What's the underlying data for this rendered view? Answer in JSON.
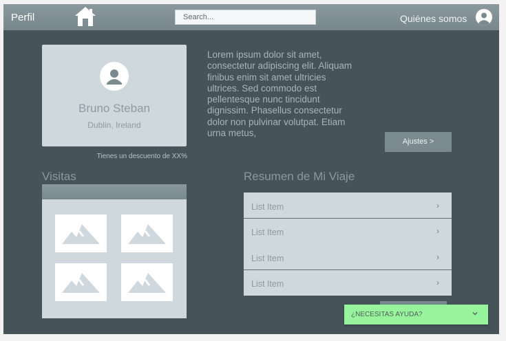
{
  "header": {
    "brand": "Perfil",
    "home_icon": "home-icon",
    "search_placeholder": "Search...",
    "about_link": "Quiénes somos",
    "user_icon": "account-circle-icon"
  },
  "profile": {
    "avatar_icon": "person-icon",
    "name": "Bruno Steban",
    "location": "Dublin, Ireland",
    "discount_note": "Tienes un descuento de XX%"
  },
  "bio": "Lorem ipsum dolor sit amet, consectetur adipiscing elit. Aliquam finibus enim sit amet ultricies ultrices. Sed commodo est pellentesque nunc tincidunt dignissim. Phasellus consectetur dolor non pulvinar volutpat. Etiam urna metus,",
  "settings_button": "Ajustes >",
  "visits": {
    "title": "Visitas",
    "thumb_icon": "image-placeholder-icon",
    "thumb_count": 4
  },
  "summary": {
    "title": "Resumen de Mi Viaje",
    "items": [
      {
        "label": "List Item",
        "chevron": "›"
      },
      {
        "label": "List Item",
        "chevron": "›"
      },
      {
        "label": "List Item",
        "chevron": "›"
      },
      {
        "label": "List Item",
        "chevron": "›"
      }
    ]
  },
  "help_widget": {
    "label": "¿NECESITAS AYUDA?",
    "icon": "chevron-down-icon"
  },
  "colors": {
    "background": "#465358",
    "header": "#8a999e",
    "card": "#cfd8dc",
    "help_accent": "#97f49c"
  }
}
